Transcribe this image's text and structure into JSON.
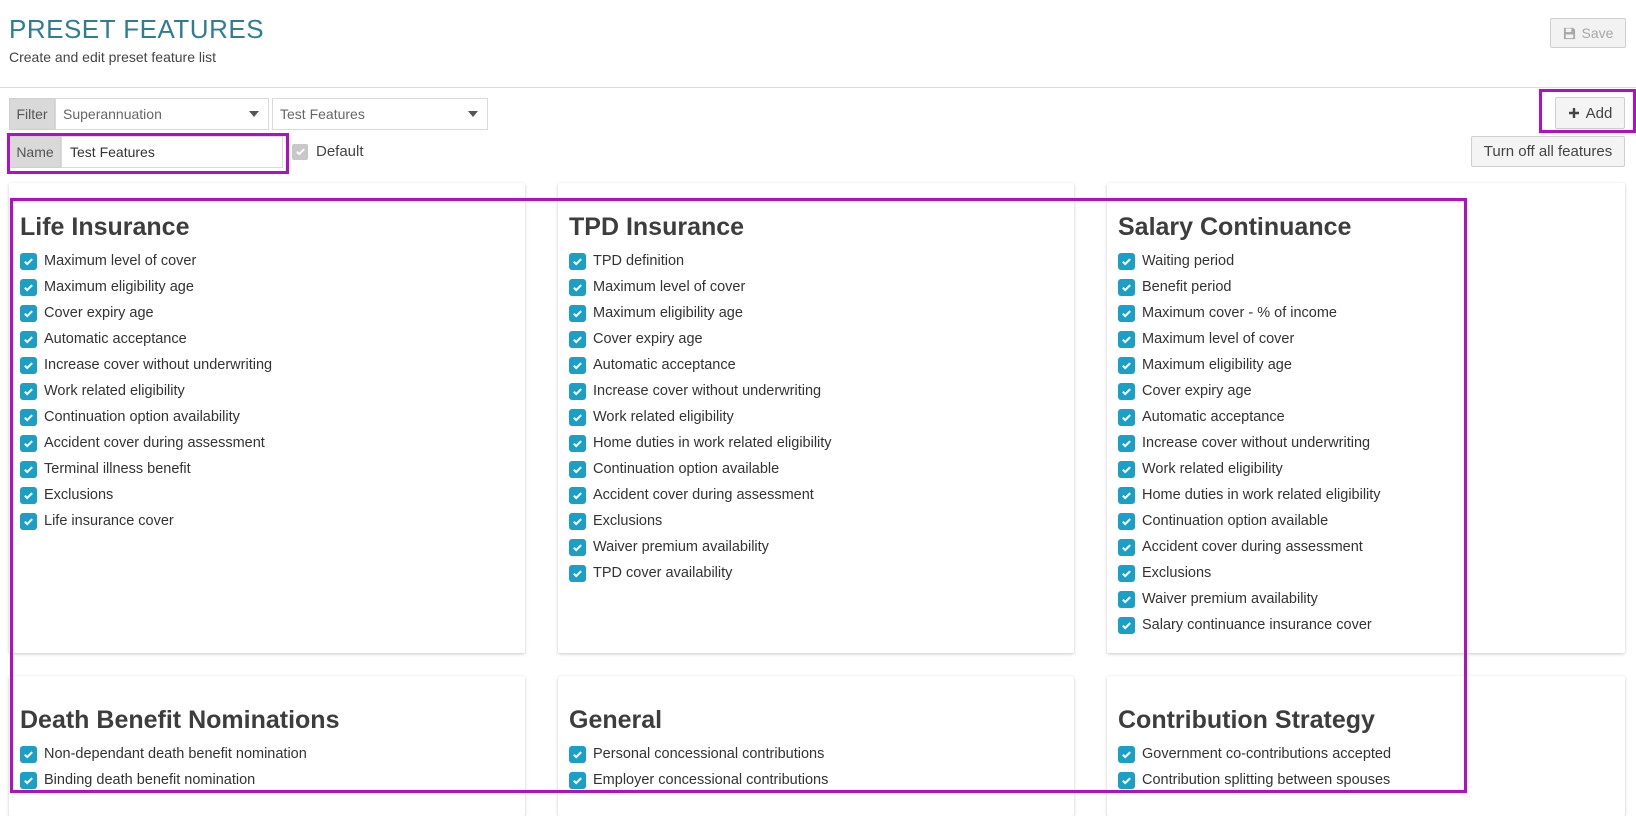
{
  "header": {
    "title": "PRESET FEATURES",
    "subtitle": "Create and edit preset feature list",
    "save_label": "Save"
  },
  "filter": {
    "label": "Filter",
    "category_selected": "Superannuation",
    "list_selected": "Test Features"
  },
  "name_field": {
    "label": "Name",
    "value": "Test Features"
  },
  "default_checkbox": {
    "label": "Default",
    "checked": true
  },
  "toolbar": {
    "add_label": "Add",
    "turn_off_label": "Turn off all features"
  },
  "colors": {
    "title": "#2f7d94",
    "checkbox": "#1aa0c7",
    "highlight": "#b10fc4"
  },
  "cards": [
    {
      "title": "Life Insurance",
      "items": [
        "Maximum level of cover",
        "Maximum eligibility age",
        "Cover expiry age",
        "Automatic acceptance",
        "Increase cover without underwriting",
        "Work related eligibility",
        "Continuation option availability",
        "Accident cover during assessment",
        "Terminal illness benefit",
        "Exclusions",
        "Life insurance cover"
      ]
    },
    {
      "title": "TPD Insurance",
      "items": [
        "TPD definition",
        "Maximum level of cover",
        "Maximum eligibility age",
        "Cover expiry age",
        "Automatic acceptance",
        "Increase cover without underwriting",
        "Work related eligibility",
        "Home duties in work related eligibility",
        "Continuation option available",
        "Accident cover during assessment",
        "Exclusions",
        "Waiver premium availability",
        "TPD cover availability"
      ]
    },
    {
      "title": "Salary Continuance",
      "items": [
        "Waiting period",
        "Benefit period",
        "Maximum cover - % of income",
        "Maximum level of cover",
        "Maximum eligibility age",
        "Cover expiry age",
        "Automatic acceptance",
        "Increase cover without underwriting",
        "Work related eligibility",
        "Home duties in work related eligibility",
        "Continuation option available",
        "Accident cover during assessment",
        "Exclusions",
        "Waiver premium availability",
        "Salary continuance insurance cover"
      ]
    },
    {
      "title": "Death Benefit Nominations",
      "items": [
        "Non-dependant death benefit nomination",
        "Binding death benefit nomination"
      ]
    },
    {
      "title": "General",
      "items": [
        "Personal concessional contributions",
        "Employer concessional contributions"
      ]
    },
    {
      "title": "Contribution Strategy",
      "items": [
        "Government co-contributions accepted",
        "Contribution splitting between spouses"
      ]
    }
  ]
}
